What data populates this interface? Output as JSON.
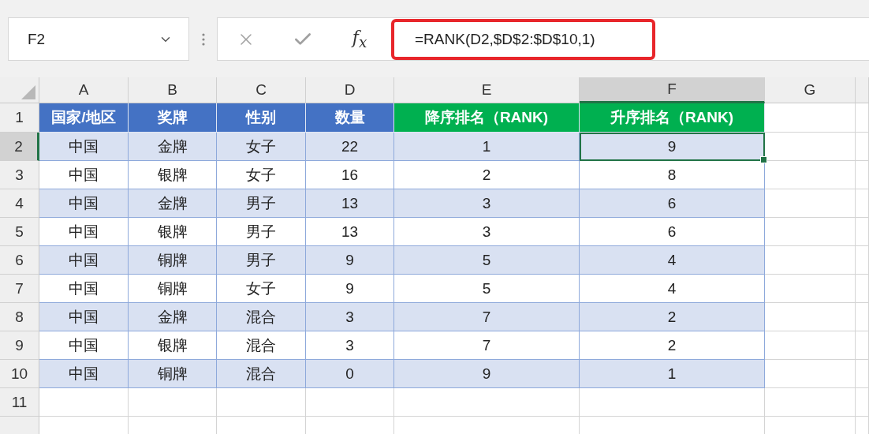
{
  "name_box": {
    "value": "F2"
  },
  "formula_bar": {
    "fx": "*f*$_{x}$",
    "formula": "=RANK(D2,$D$2:$D$10,1)",
    "highlighted": true
  },
  "columns": [
    {
      "label": "A",
      "selected": false
    },
    {
      "label": "B",
      "selected": false
    },
    {
      "label": "C",
      "selected": false
    },
    {
      "label": "D",
      "selected": false
    },
    {
      "label": "E",
      "selected": false
    },
    {
      "label": "F",
      "selected": true
    },
    {
      "label": "G",
      "selected": false
    }
  ],
  "rows": [
    {
      "header": "1",
      "kind": "header",
      "selected": false,
      "cells": [
        {
          "text": "国家/地区",
          "color": "#4472c4"
        },
        {
          "text": "奖牌",
          "color": "#4472c4"
        },
        {
          "text": "性别",
          "color": "#4472c4"
        },
        {
          "text": "数量",
          "color": "#4472c4"
        },
        {
          "text": "降序排名（RANK)",
          "color": "#00b050"
        },
        {
          "text": "升序排名（RANK)",
          "color": "#00b050"
        }
      ]
    },
    {
      "header": "2",
      "kind": "data",
      "shaded": true,
      "selected": true,
      "cells": [
        "中国",
        "金牌",
        "女子",
        "22",
        "1",
        "9"
      ]
    },
    {
      "header": "3",
      "kind": "data",
      "shaded": false,
      "selected": false,
      "cells": [
        "中国",
        "银牌",
        "女子",
        "16",
        "2",
        "8"
      ]
    },
    {
      "header": "4",
      "kind": "data",
      "shaded": true,
      "selected": false,
      "cells": [
        "中国",
        "金牌",
        "男子",
        "13",
        "3",
        "6"
      ]
    },
    {
      "header": "5",
      "kind": "data",
      "shaded": false,
      "selected": false,
      "cells": [
        "中国",
        "银牌",
        "男子",
        "13",
        "3",
        "6"
      ]
    },
    {
      "header": "6",
      "kind": "data",
      "shaded": true,
      "selected": false,
      "cells": [
        "中国",
        "铜牌",
        "男子",
        "9",
        "5",
        "4"
      ]
    },
    {
      "header": "7",
      "kind": "data",
      "shaded": false,
      "selected": false,
      "cells": [
        "中国",
        "铜牌",
        "女子",
        "9",
        "5",
        "4"
      ]
    },
    {
      "header": "8",
      "kind": "data",
      "shaded": true,
      "selected": false,
      "cells": [
        "中国",
        "金牌",
        "混合",
        "3",
        "7",
        "2"
      ]
    },
    {
      "header": "9",
      "kind": "data",
      "shaded": false,
      "selected": false,
      "cells": [
        "中国",
        "银牌",
        "混合",
        "3",
        "7",
        "2"
      ]
    },
    {
      "header": "10",
      "kind": "data",
      "shaded": true,
      "selected": false,
      "cells": [
        "中国",
        "铜牌",
        "混合",
        "0",
        "9",
        "1"
      ]
    },
    {
      "header": "11",
      "kind": "empty",
      "selected": false
    },
    {
      "kind": "empty",
      "selected": false
    }
  ]
}
